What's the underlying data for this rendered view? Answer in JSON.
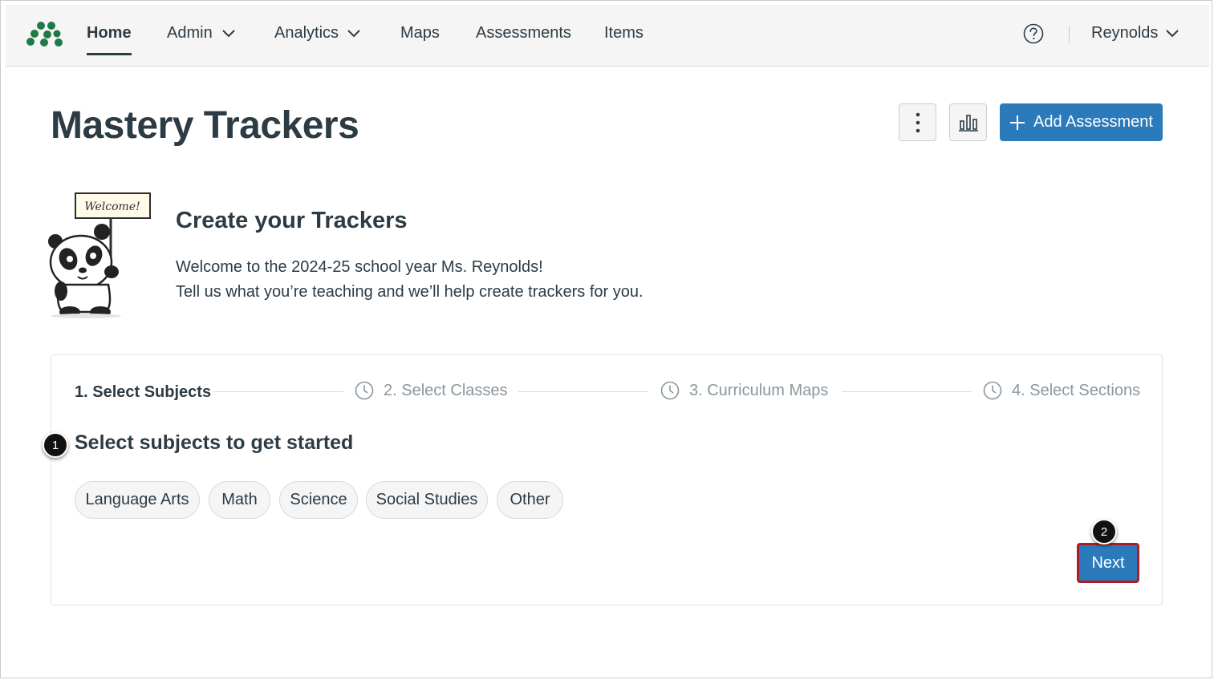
{
  "nav": {
    "home": "Home",
    "admin": "Admin",
    "analytics": "Analytics",
    "maps": "Maps",
    "assessments": "Assessments",
    "items": "Items",
    "user": "Reynolds"
  },
  "header": {
    "title": "Mastery Trackers",
    "add_assessment": "Add Assessment"
  },
  "welcome": {
    "sign": "Welcome!",
    "title": "Create your Trackers",
    "line1": "Welcome to the 2024-25 school year Ms. Reynolds!",
    "line2": "Tell us what you’re teaching and we’ll help create trackers for you."
  },
  "steps": [
    {
      "label": "1. Select Subjects"
    },
    {
      "label": "2.  Select Classes"
    },
    {
      "label": "3.  Curriculum Maps"
    },
    {
      "label": "4.  Select Sections"
    }
  ],
  "subjects": {
    "title": "Select subjects to get started",
    "options": [
      "Language Arts",
      "Math",
      "Science",
      "Social Studies",
      "Other"
    ]
  },
  "next_label": "Next",
  "callouts": [
    "1",
    "2"
  ],
  "colors": {
    "primary": "#2b7abc",
    "text": "#2d3b45",
    "muted": "#8b969e",
    "logo_green": "#1e7a46",
    "highlight_border": "#b01c25"
  }
}
